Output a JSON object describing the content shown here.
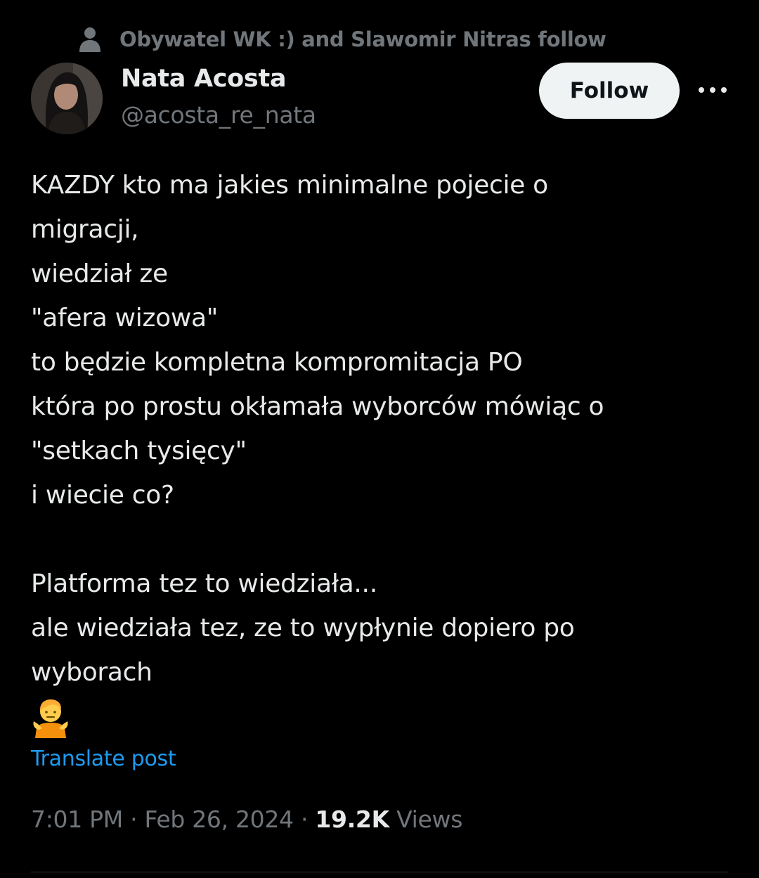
{
  "social_context": {
    "icon": "person-icon",
    "text": "Obywatel WK :) and Slawomir Nitras follow"
  },
  "author": {
    "avatar": "avatar",
    "display_name": "Nata Acosta",
    "handle": "@acosta_re_nata"
  },
  "actions": {
    "follow_label": "Follow",
    "more_icon": "more-icon"
  },
  "post": {
    "lines": [
      "KAZDY kto ma jakies minimalne pojecie o",
      "migracji,",
      "wiedział ze",
      "\"afera wizowa\"",
      "to będzie kompletna kompromitacja PO",
      "która po prostu okłamała wyborców mówiąc o",
      "\"setkach tysięcy\"",
      "i wiecie co?",
      "",
      "Platforma tez to wiedziała...",
      "ale wiedziała tez, ze to wypłynie dopiero po",
      "wyborach"
    ],
    "emoji": "person-shrugging-emoji",
    "translate_label": "Translate post"
  },
  "meta": {
    "time": "7:01 PM",
    "separator": "·",
    "date": "Feb 26, 2024",
    "views_count": "19.2K",
    "views_label": "Views"
  },
  "colors": {
    "background": "#000000",
    "primary_text": "#e7e9ea",
    "secondary_text": "#71767b",
    "link": "#1d9bf0",
    "follow_button_bg": "#eff3f4",
    "follow_button_text": "#0f1419"
  }
}
